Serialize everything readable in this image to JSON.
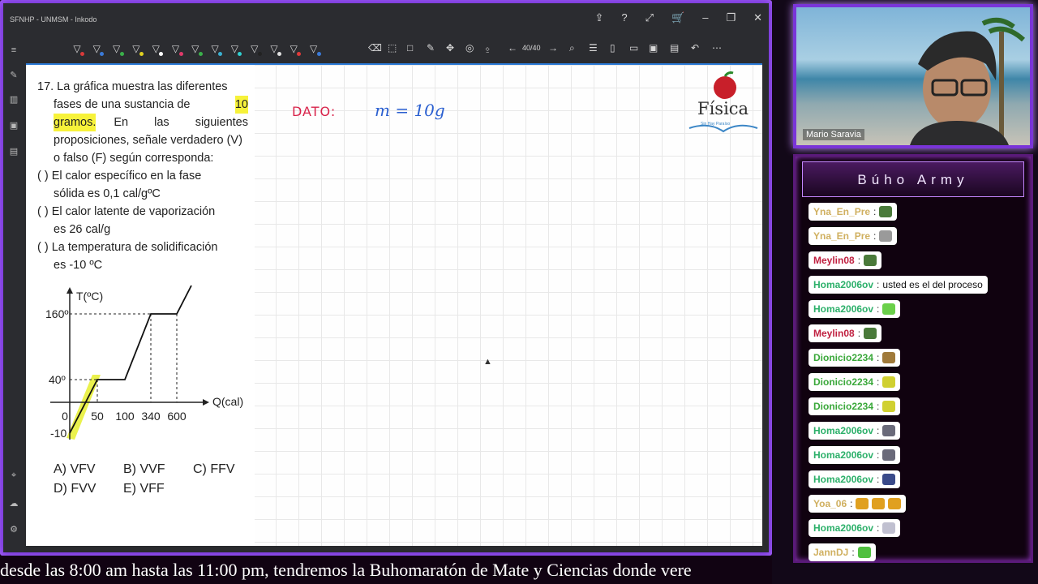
{
  "window": {
    "title": "SFNHP - UNMSM - Inkodo",
    "page_indicator": "40/40"
  },
  "toolbar": {
    "pen_colors": [
      "#d83a3a",
      "#3a7ad8",
      "#3ab04a",
      "#e0d020",
      "#ffffff",
      "#e03a6a",
      "#3ab04a",
      "#3ab0d0",
      "#30d0d0",
      "#222222",
      "#e0e0e0",
      "#e03a3a",
      "#3a7ad8"
    ]
  },
  "question": {
    "line1": "17. La gráfica muestra las diferentes",
    "line2_pre": "fases de una sustancia de",
    "line2_hl": "10",
    "line3_hl": "gramos.",
    "line3_post": "En las siguientes",
    "line4": "proposiciones, señale verdadero (V)",
    "line5": "o falso (F) según corresponda:",
    "p1_a": "(   )   El calor específico en la fase",
    "p1_b": "sólida es 0,1 cal/gºC",
    "p2_a": "(   )   El calor latente de vaporización",
    "p2_b": "es 26 cal/g",
    "p3_a": "(   )   La temperatura de solidificación",
    "p3_b": "es -10 ºC",
    "options": {
      "a": "A) VFV",
      "b": "B) VVF",
      "c": "C) FFV",
      "d": "D) FVV",
      "e": "E) VFF"
    }
  },
  "chart_data": {
    "type": "line",
    "ylabel": "T(ºC)",
    "xlabel": "Q(cal)",
    "x_ticks": [
      "0",
      "50",
      "100",
      "340",
      "600"
    ],
    "y_ticks": [
      "160º",
      "40º",
      "-10"
    ],
    "x": [
      0,
      50,
      100,
      340,
      600,
      700
    ],
    "y": [
      -10,
      40,
      40,
      160,
      160,
      200
    ],
    "highlight_segment": [
      0,
      50
    ]
  },
  "annotation": {
    "dato": "DATO:",
    "equation": "m = 10g"
  },
  "logo": {
    "word": "Física",
    "slogan": "Sin Hay Paraíso"
  },
  "webcam": {
    "name": "Mario Saravia"
  },
  "chat": {
    "title": "Búho Army",
    "messages": [
      {
        "user": "Yna_En_Pre",
        "color": "#d0b060",
        "text": "",
        "emotes": 1,
        "emo_color": "#4a7a3a"
      },
      {
        "user": "Yna_En_Pre",
        "color": "#d0b060",
        "text": "",
        "emotes": 1,
        "emo_color": "#9a9a9a"
      },
      {
        "user": "Meylin08",
        "color": "#c02040",
        "text": "",
        "emotes": 1,
        "emo_color": "#4a7a3a"
      },
      {
        "user": "Homa2006ov",
        "color": "#2cb06a",
        "text": "usted es el del proceso",
        "emotes": 0,
        "emo_color": ""
      },
      {
        "user": "Homa2006ov",
        "color": "#2cb06a",
        "text": "",
        "emotes": 1,
        "emo_color": "#6ad04a"
      },
      {
        "user": "Meylin08",
        "color": "#c02040",
        "text": "",
        "emotes": 1,
        "emo_color": "#4a7a3a"
      },
      {
        "user": "Dionicio2234",
        "color": "#3aa83a",
        "text": "",
        "emotes": 1,
        "emo_color": "#a07a3a"
      },
      {
        "user": "Dionicio2234",
        "color": "#3aa83a",
        "text": "",
        "emotes": 1,
        "emo_color": "#d0d030"
      },
      {
        "user": "Dionicio2234",
        "color": "#3aa83a",
        "text": "",
        "emotes": 1,
        "emo_color": "#d0d030"
      },
      {
        "user": "Homa2006ov",
        "color": "#2cb06a",
        "text": "",
        "emotes": 1,
        "emo_color": "#6a6a7a"
      },
      {
        "user": "Homa2006ov",
        "color": "#2cb06a",
        "text": "",
        "emotes": 1,
        "emo_color": "#6a6a7a"
      },
      {
        "user": "Homa2006ov",
        "color": "#2cb06a",
        "text": "",
        "emotes": 1,
        "emo_color": "#3a4a8a"
      },
      {
        "user": "Yoa_06",
        "color": "#d0b060",
        "text": "",
        "emotes": 3,
        "emo_color": "#e0a020"
      },
      {
        "user": "Homa2006ov",
        "color": "#2cb06a",
        "text": "",
        "emotes": 1,
        "emo_color": "#c0c0d0"
      },
      {
        "user": "JannDJ",
        "color": "#d0b060",
        "text": "",
        "emotes": 1,
        "emo_color": "#50c040"
      }
    ]
  },
  "ticker": {
    "text": "desde las 8:00 am hasta las 11:00 pm, tendremos la Buhomaratón de Mate y Ciencias donde vere"
  }
}
